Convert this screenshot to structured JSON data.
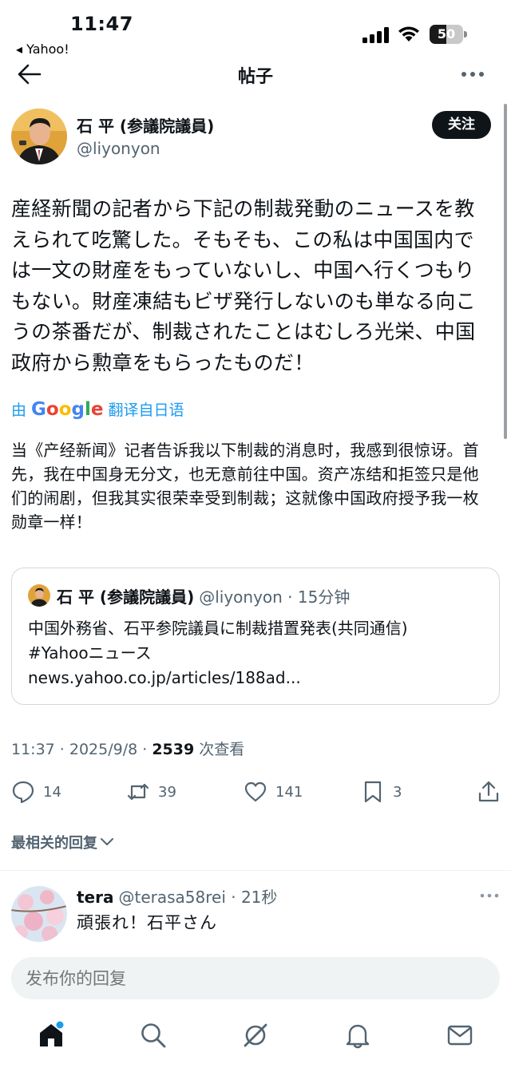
{
  "status_bar": {
    "time": "11:47",
    "back_app": "◂ Yahoo!",
    "battery": "50",
    "battery_level": 0.5
  },
  "header": {
    "title": "帖子"
  },
  "post": {
    "author_name": "石 平 (参議院議員)",
    "author_handle": "@liyonyon",
    "follow_label": "关注",
    "text": "産経新聞の記者から下記の制裁発動のニュースを教えられて吃驚した。そもそも、この私は中国国内では一文の財産をもっていないし、中国へ行くつもりもない。財産凍結もビザ発行しないのも単なる向こうの茶番だが、制裁されたことはむしろ光栄、中国政府から勲章をもらったものだ！",
    "translate": {
      "prefix": "由",
      "brand": "Google",
      "suffix": "翻译自日语"
    },
    "translated_text": "当《产经新闻》记者告诉我以下制裁的消息时，我感到很惊讶。首先，我在中国身无分文，也无意前往中国。资产冻结和拒签只是他们的闹剧，但我其实很荣幸受到制裁；这就像中国政府授予我一枚勋章一样！",
    "quote": {
      "author_name": "石 平 (参議院議員)",
      "meta": "@liyonyon · 15分钟",
      "line1": "中国外務省、石平参院議員に制裁措置発表(共同通信)",
      "line2": "#Yahooニュース",
      "line3": "news.yahoo.co.jp/articles/188ad..."
    },
    "timestamp": "11:37 · 2025/9/8 · ",
    "views_count": "2539",
    "views_label": " 次查看",
    "actions": {
      "replies": "14",
      "reposts": "39",
      "likes": "141",
      "bookmarks": "3"
    }
  },
  "replies_section": {
    "sort_label": "最相关的回复",
    "reply": {
      "name": "tera",
      "meta": "@terasa58rei · 21秒",
      "text": "頑張れ！石平さん"
    }
  },
  "composer": {
    "placeholder": "发布你的回复"
  },
  "tab_bar": {
    "items": [
      "home-icon",
      "search-icon",
      "grok-icon",
      "notifications-icon",
      "messages-icon"
    ]
  },
  "colors": {
    "accent": "#1d9bf0",
    "text": "#0f1419",
    "secondary": "#536471"
  }
}
